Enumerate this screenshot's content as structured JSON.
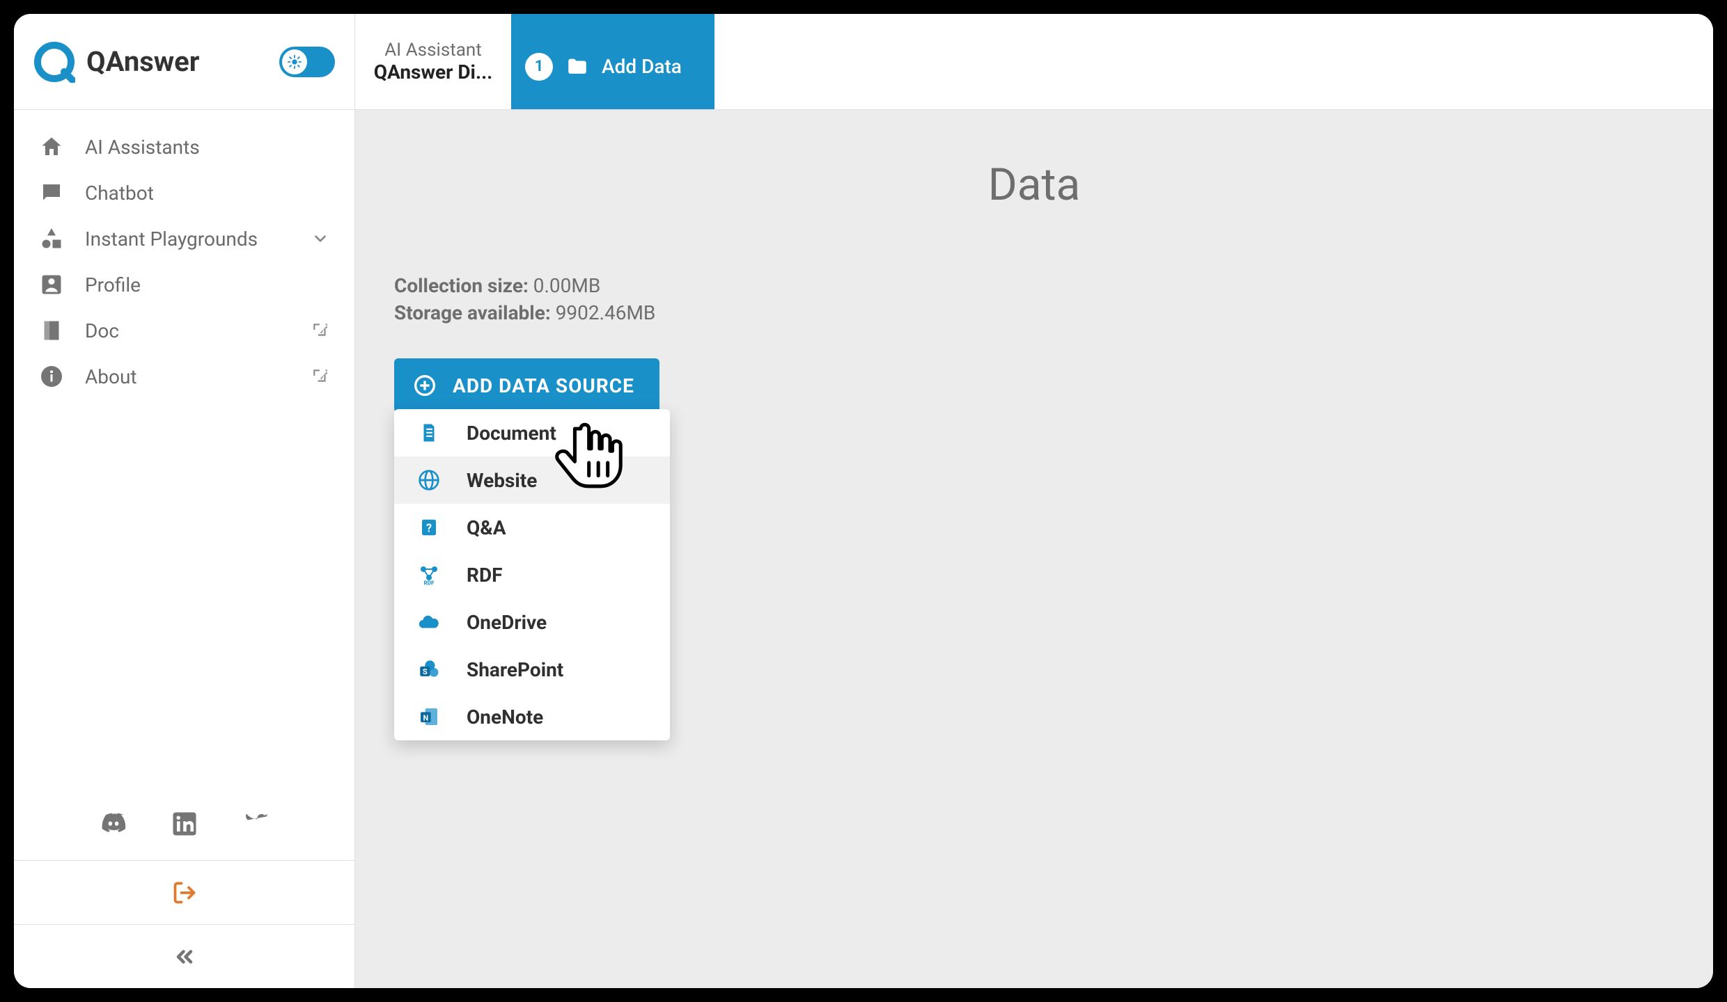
{
  "brand": "QAnswer",
  "sidebar": {
    "items": [
      {
        "label": "AI Assistants"
      },
      {
        "label": "Chatbot"
      },
      {
        "label": "Instant Playgrounds"
      },
      {
        "label": "Profile"
      },
      {
        "label": "Doc"
      },
      {
        "label": "About"
      }
    ]
  },
  "breadcrumb": {
    "top": "AI Assistant",
    "bottom": "QAnswer Di..."
  },
  "tab": {
    "step": "1",
    "label": "Add Data"
  },
  "page": {
    "title": "Data",
    "collection_size_label": "Collection size:",
    "collection_size_value": "0.00MB",
    "storage_available_label": "Storage available:",
    "storage_available_value": "9902.46MB"
  },
  "add_source_button": "ADD DATA SOURCE",
  "dropdown": {
    "items": [
      {
        "label": "Document"
      },
      {
        "label": "Website",
        "hovered": true
      },
      {
        "label": "Q&A"
      },
      {
        "label": "RDF"
      },
      {
        "label": "OneDrive"
      },
      {
        "label": "SharePoint"
      },
      {
        "label": "OneNote"
      }
    ]
  },
  "colors": {
    "accent": "#1a90c9",
    "logout": "#e07a2e"
  }
}
